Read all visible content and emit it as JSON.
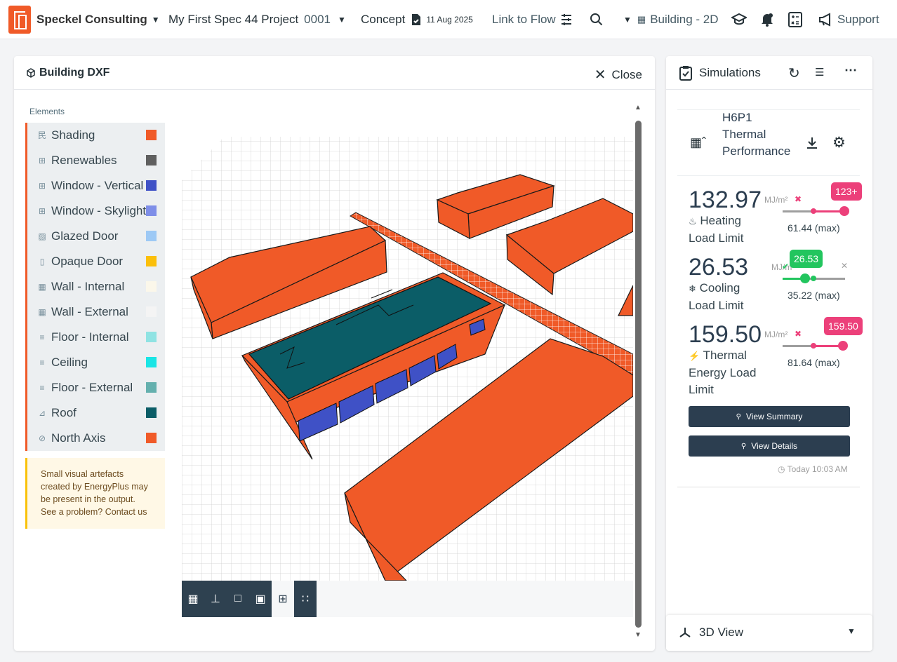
{
  "header": {
    "company": "Speckel Consulting",
    "project": "My First Spec 44 Project",
    "project_code": "0001",
    "stage": "Concept",
    "date": "11 Aug 2025",
    "link_flow": "Link to Flow",
    "view": "Building - 2D",
    "support": "Support"
  },
  "left_panel": {
    "title": "Building DXF",
    "close_label": "Close",
    "elements_heading": "Elements",
    "elements": [
      {
        "label": "Shading",
        "icon": "shading-icon",
        "color": "#f05a28"
      },
      {
        "label": "Renewables",
        "icon": "solar-panel-icon",
        "color": "#5f5f5f"
      },
      {
        "label": "Window - Vertical",
        "icon": "window-icon",
        "color": "#3f51c6"
      },
      {
        "label": "Window - Skylight",
        "icon": "window-icon",
        "color": "#7e8ee8"
      },
      {
        "label": "Glazed Door",
        "icon": "glazed-door-icon",
        "color": "#9dc9f5"
      },
      {
        "label": "Opaque Door",
        "icon": "door-icon",
        "color": "#fbbf0a"
      },
      {
        "label": "Wall - Internal",
        "icon": "brick-wall-icon",
        "color": "#fbf7ea"
      },
      {
        "label": "Wall - External",
        "icon": "brick-wall-icon",
        "color": "#f4f4f4"
      },
      {
        "label": "Floor - Internal",
        "icon": "floor-icon",
        "color": "#8fe3e3"
      },
      {
        "label": "Ceiling",
        "icon": "floor-icon",
        "color": "#19e5e5"
      },
      {
        "label": "Floor - External",
        "icon": "floor-icon",
        "color": "#64b0ae"
      },
      {
        "label": "Roof",
        "icon": "roof-icon",
        "color": "#0b5d67"
      },
      {
        "label": "North Axis",
        "icon": "compass-icon",
        "color": "#f05a28"
      }
    ],
    "note": [
      "Small visual artefacts",
      "created by EnergyPlus may",
      "be present in the output.",
      "See a problem? Contact us"
    ]
  },
  "simulations": {
    "title": "Simulations",
    "model_lines": [
      "H6P1",
      "Thermal",
      "Performance"
    ],
    "metrics": [
      {
        "value": "132.97",
        "unit": "MJ/m²",
        "label_lines": [
          "Heating",
          "Load Limit"
        ],
        "bubble": "123+",
        "max": "61.44 (max)",
        "status": "fail",
        "position": 1.0
      },
      {
        "value": "26.53",
        "unit": "MJ/m²",
        "label_lines": [
          "Cooling",
          "Load Limit"
        ],
        "bubble": "26.53",
        "max": "35.22 (max)",
        "status": "pass",
        "position": 0.36
      },
      {
        "value": "159.50",
        "unit": "MJ/m²",
        "label_lines": [
          "Thermal",
          "Energy Load",
          "Limit"
        ],
        "bubble": "159.50",
        "max": "81.64 (max)",
        "status": "fail",
        "position": 0.98
      }
    ],
    "view_summary": "View Summary",
    "view_details": "View Details",
    "timestamp": "Today 10:03 AM",
    "view3d": "3D View"
  },
  "colors": {
    "accent": "#f05a28",
    "fail": "#ec407a",
    "pass": "#22c55e",
    "dark": "#2c3e50"
  }
}
